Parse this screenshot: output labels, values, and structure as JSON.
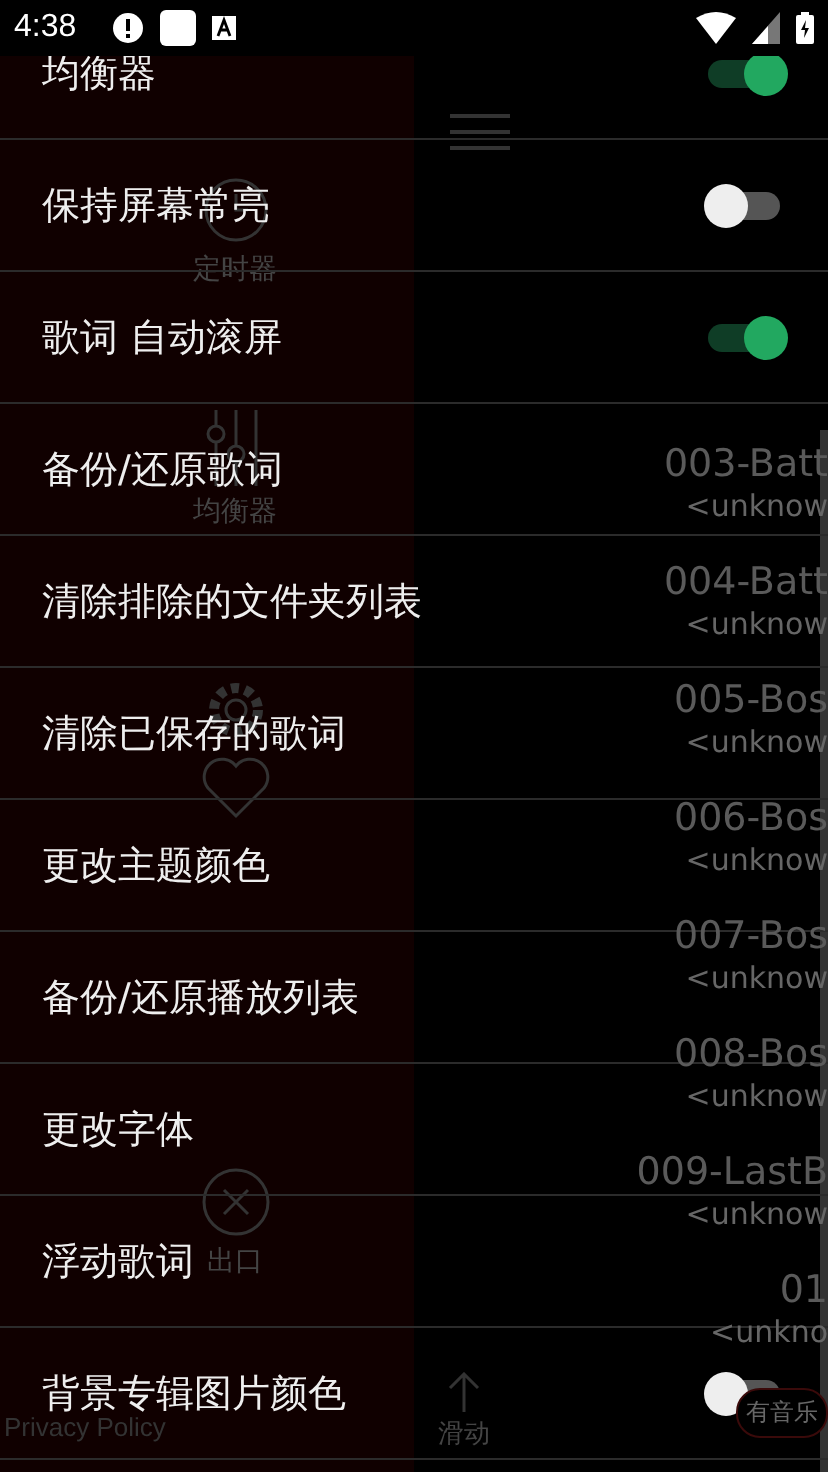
{
  "status_bar": {
    "time": "4:38"
  },
  "background": {
    "drawer_items": [
      {
        "kind": "clock",
        "label": "定时器"
      },
      {
        "kind": "equalizer",
        "label": "均衡器"
      },
      {
        "kind": "gear"
      },
      {
        "kind": "heart"
      },
      {
        "kind": "close",
        "label": "出口"
      }
    ],
    "privacy_link": "Privacy Policy",
    "swipe_hint": "滑动",
    "tracks": [
      {
        "title": "003-Batt",
        "artist": "<unknow"
      },
      {
        "title": "004-Batt",
        "artist": "<unknow"
      },
      {
        "title": "005-Bos",
        "artist": "<unknow"
      },
      {
        "title": "006-Bos",
        "artist": "<unknow"
      },
      {
        "title": "007-Bos",
        "artist": "<unknow"
      },
      {
        "title": "008-Bos",
        "artist": "<unknow"
      },
      {
        "title": "009-LastB",
        "artist": "<unknow"
      },
      {
        "title": "01",
        "artist": "<unkno"
      }
    ],
    "music_badge": "有音乐"
  },
  "settings": [
    {
      "label": "均衡器",
      "kind": "toggle",
      "on": true
    },
    {
      "label": "保持屏幕常亮",
      "kind": "toggle",
      "on": false
    },
    {
      "label": "歌词 自动滚屏",
      "kind": "toggle",
      "on": true
    },
    {
      "label": "备份/还原歌词",
      "kind": "action"
    },
    {
      "label": "清除排除的文件夹列表",
      "kind": "action"
    },
    {
      "label": "清除已保存的歌词",
      "kind": "action"
    },
    {
      "label": "更改主题颜色",
      "kind": "action"
    },
    {
      "label": "备份/还原播放列表",
      "kind": "action"
    },
    {
      "label": "更改字体",
      "kind": "action"
    },
    {
      "label": "浮动歌词",
      "kind": "action"
    },
    {
      "label": "背景专辑图片颜色",
      "kind": "toggle",
      "on": false
    }
  ]
}
